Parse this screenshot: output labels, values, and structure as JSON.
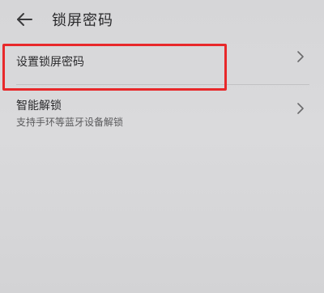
{
  "header": {
    "title": "锁屏密码",
    "back_icon": "arrow-left-icon"
  },
  "settings": {
    "items": [
      {
        "label": "设置锁屏密码",
        "icon": "chevron-right-icon",
        "highlighted": true
      },
      {
        "label": "智能解锁",
        "sublabel": "支持手环等蓝牙设备解锁",
        "icon": "chevron-right-icon"
      }
    ]
  },
  "colors": {
    "background": "#d8d8da",
    "highlight": "#e8282a",
    "text": "#2b2b2d",
    "subtext": "#5a5a5c"
  }
}
